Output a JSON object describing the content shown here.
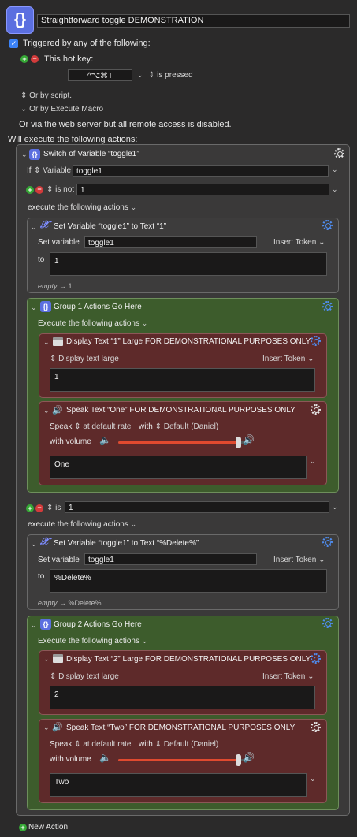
{
  "macro": {
    "name": "Straightforward toggle DEMONSTRATION"
  },
  "trigger": {
    "header": "Triggered by any of the following:",
    "hotkey_label": "This hot key:",
    "hotkey_value": "^⌥⌘T",
    "hotkey_state": "is pressed",
    "or_script": "Or by script.",
    "or_execute_macro": "Or by Execute Macro",
    "web_server_note": "Or via the web server but all remote access is disabled."
  },
  "actions_header": "Will execute the following actions:",
  "switch": {
    "title": "Switch of Variable “toggle1”",
    "if_label": "If",
    "source_label": "Variable",
    "variable": "toggle1",
    "cases": [
      {
        "operator": "is not",
        "value": "1",
        "execute_label": "execute the following actions",
        "set": {
          "title": "Set Variable “toggle1” to Text “1”",
          "label": "Set variable",
          "variable": "toggle1",
          "insert_token": "Insert Token",
          "to_label": "to",
          "to_value": "1",
          "empty_label": "empty",
          "preview": "1"
        },
        "group": {
          "title": "Group 1 Actions Go Here",
          "execute_label": "Execute the following actions",
          "display": {
            "title": "Display Text “1” Large FOR DEMONSTRATIONAL PURPOSES ONLY",
            "mode": "Display text large",
            "insert_token": "Insert Token",
            "text": "1"
          },
          "speak": {
            "title": "Speak Text “One” FOR DEMONSTRATIONAL PURPOSES ONLY",
            "speak_label": "Speak",
            "rate": "at default rate",
            "with_label": "with",
            "voice": "Default (Daniel)",
            "volume_label": "with volume",
            "volume": 0.95,
            "text": "One"
          }
        }
      },
      {
        "operator": "is",
        "value": "1",
        "execute_label": "execute the following actions",
        "set": {
          "title": "Set Variable “toggle1” to Text “%Delete%”",
          "label": "Set variable",
          "variable": "toggle1",
          "insert_token": "Insert Token",
          "to_label": "to",
          "to_value": "%Delete%",
          "empty_label": "empty",
          "preview": "%Delete%"
        },
        "group": {
          "title": "Group 2 Actions Go Here",
          "execute_label": "Execute the following actions",
          "display": {
            "title": "Display Text “2” Large FOR DEMONSTRATIONAL PURPOSES ONLY",
            "mode": "Display text large",
            "insert_token": "Insert Token",
            "text": "2"
          },
          "speak": {
            "title": "Speak Text “Two” FOR DEMONSTRATIONAL PURPOSES ONLY",
            "speak_label": "Speak",
            "rate": "at default rate",
            "with_label": "with",
            "voice": "Default (Daniel)",
            "volume_label": "with volume",
            "volume": 0.95,
            "text": "Two"
          }
        }
      }
    ]
  },
  "new_action": "New Action",
  "icons": [
    "braces-icon",
    "checkbox-icon",
    "add-icon",
    "remove-icon",
    "variable-x-icon",
    "window-icon",
    "speaker-icon",
    "gear-icon"
  ],
  "colors": {
    "group_green": "#3d5c2c",
    "action_red": "#5e2a2a",
    "accent_blue": "#5b6fe0",
    "slider_red": "#e04a2f"
  }
}
